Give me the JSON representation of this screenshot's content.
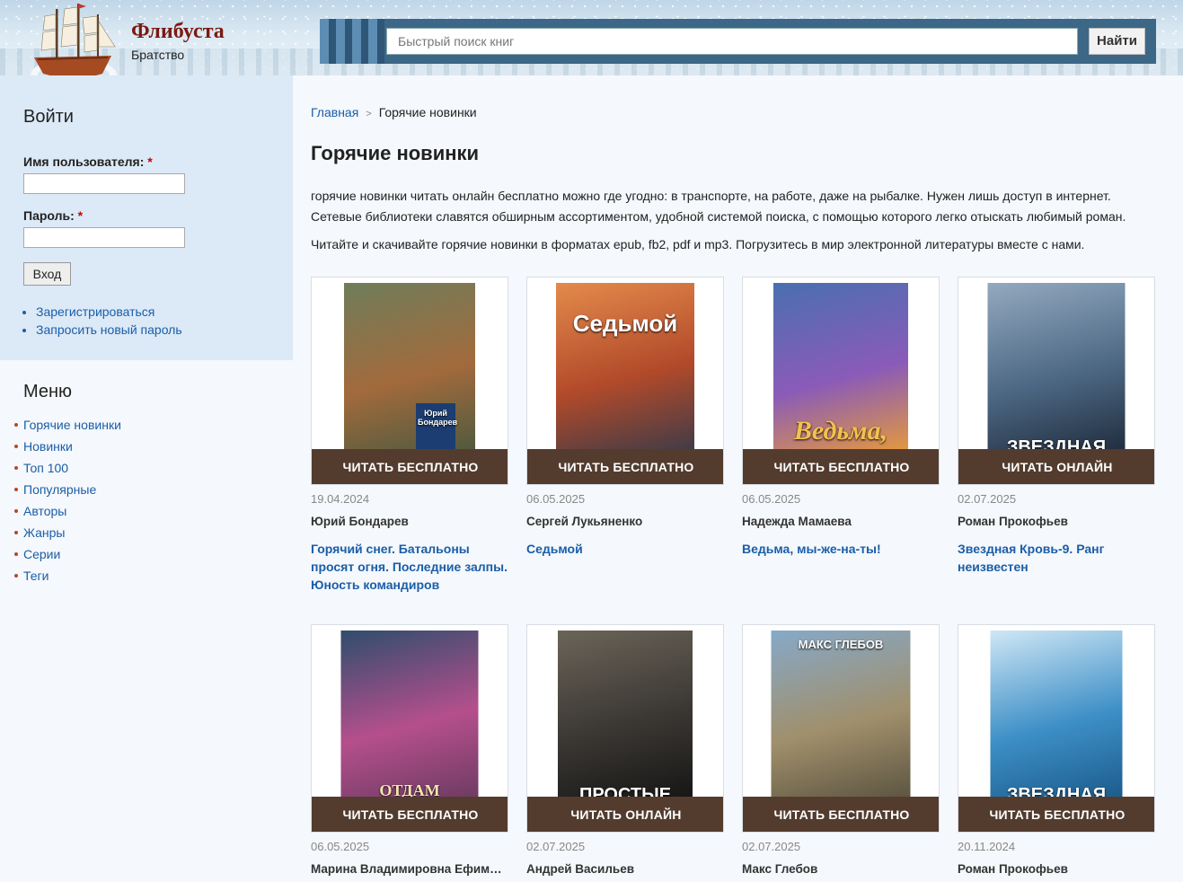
{
  "site": {
    "name": "Флибуста",
    "slogan": "Братство"
  },
  "search": {
    "placeholder": "Быстрый поиск книг",
    "button": "Найти"
  },
  "login": {
    "title": "Войти",
    "username_label": "Имя пользователя:",
    "password_label": "Пароль:",
    "required_mark": "*",
    "submit": "Вход",
    "links": [
      "Зарегистрироваться",
      "Запросить новый пароль"
    ]
  },
  "menu": {
    "title": "Меню",
    "items": [
      "Горячие новинки",
      "Новинки",
      "Топ 100",
      "Популярные",
      "Авторы",
      "Жанры",
      "Серии",
      "Теги"
    ]
  },
  "breadcrumb": {
    "home": "Главная",
    "separator": ">",
    "current": "Горячие новинки"
  },
  "page": {
    "title": "Горячие новинки",
    "intro": "горячие новинки читать онлайн бесплатно можно где угодно: в транспорте, на работе, даже на рыбалке. Нужен лишь доступ в интернет. Сетевые библиотеки славятся обширным ассортиментом, удобной системой поиска, с помощью которого легко отыскать любимый роман.",
    "intro2": "Читайте и скачивайте горячие новинки в форматах epub, fb2, pdf и mp3. Погрузитесь в мир электронной литературы вместе с нами."
  },
  "books": [
    {
      "button": "ЧИТАТЬ БЕСПЛАТНО",
      "date": "19.04.2024",
      "author": "Юрий Бондарев",
      "title": "Горячий снег. Батальоны просят огня. Последние залпы. Юность командиров",
      "cover_text": "Юрий Бондарев",
      "cover_colors": [
        "#6f7d5a",
        "#a26a3c",
        "#4d5a3f"
      ]
    },
    {
      "button": "ЧИТАТЬ БЕСПЛАТНО",
      "date": "06.05.2025",
      "author": "Сергей Лукьяненко",
      "title": "Седьмой",
      "cover_text": "Седьмой",
      "cover_colors": [
        "#e38a4c",
        "#b24a2a",
        "#3d3b48"
      ]
    },
    {
      "button": "ЧИТАТЬ БЕСПЛАТНО",
      "date": "06.05.2025",
      "author": "Надежда Мамаева",
      "title": "Ведьма, мы-же-на-ты!",
      "cover_text": "Ведьма,",
      "cover_colors": [
        "#4a6fb0",
        "#8a5bb8",
        "#e79a3a"
      ]
    },
    {
      "button": "ЧИТАТЬ ОНЛАЙН",
      "date": "02.07.2025",
      "author": "Роман Прокофьев",
      "title": "Звездная Кровь-9. Ранг неизвестен",
      "cover_text": "ЗВЕЗДНАЯ",
      "cover_colors": [
        "#93a9bf",
        "#4d6884",
        "#1f2c3c"
      ]
    },
    {
      "button": "ЧИТАТЬ БЕСПЛАТНО",
      "date": "06.05.2025",
      "author": "Марина Владимировна Ефимиченко",
      "title": "",
      "cover_text": "ОТДАМ ДРАКОНА",
      "cover_colors": [
        "#2f4d6d",
        "#b54f8c",
        "#6b3b62"
      ]
    },
    {
      "button": "ЧИТАТЬ ОНЛАЙН",
      "date": "02.07.2025",
      "author": "Андрей Васильев",
      "title": "",
      "cover_text": "ПРОСТЫЕ",
      "cover_colors": [
        "#6b6458",
        "#3a3733",
        "#161514"
      ]
    },
    {
      "button": "ЧИТАТЬ БЕСПЛАТНО",
      "date": "02.07.2025",
      "author": "Макс Глебов",
      "title": "",
      "cover_text": "МАКС ГЛЕБОВ",
      "cover_colors": [
        "#86a9c9",
        "#a08f6b",
        "#5a5340"
      ]
    },
    {
      "button": "ЧИТАТЬ БЕСПЛАТНО",
      "date": "20.11.2024",
      "author": "Роман Прокофьев",
      "title": "",
      "cover_text": "ЗВЕЗДНАЯ",
      "cover_colors": [
        "#cfe7f5",
        "#3d8fc7",
        "#1b5a8a"
      ]
    }
  ]
}
